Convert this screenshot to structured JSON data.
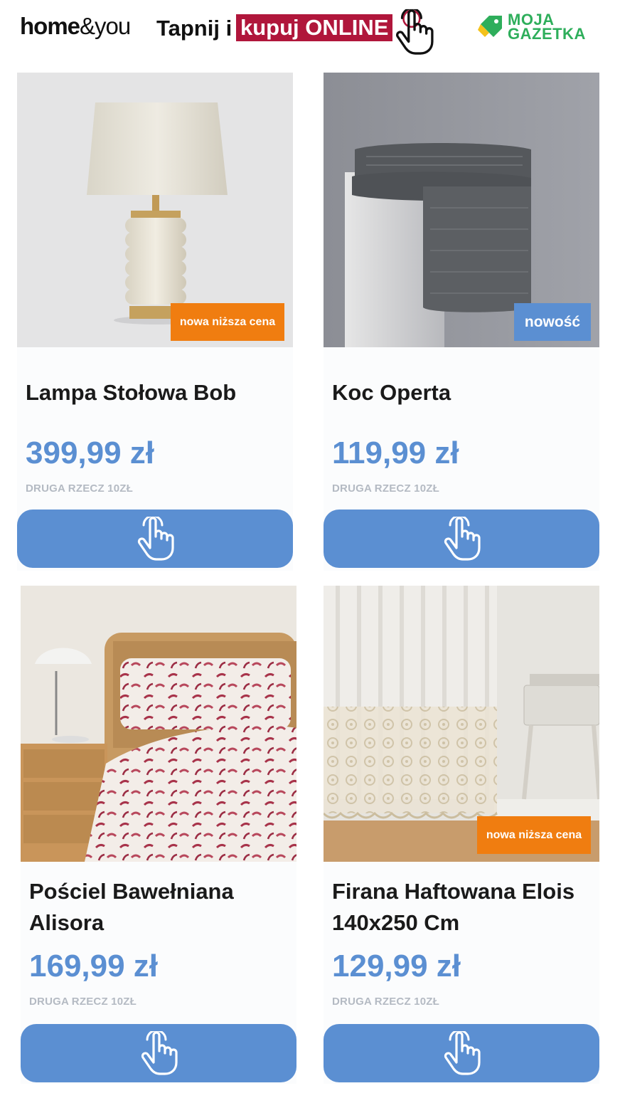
{
  "header": {
    "brand_home": "home",
    "brand_amp": "&",
    "brand_you": "you",
    "tapnij": "Tapnij i",
    "kupuj": "kupuj ONLINE",
    "moja": "MOJA",
    "gazetka": "GAZETKA",
    "accent_color": "#b0163b",
    "gazetka_color": "#2eae5b"
  },
  "products": [
    {
      "title_line1": "Lampa Stołowa Bob",
      "title_line2": "",
      "price": "399,99 zł",
      "promo": "DRUGA RZECZ 10ZŁ",
      "badge": "nowa niższa cena",
      "badge_color": "#f07d10",
      "button_icon": "tap-hand-icon"
    },
    {
      "title_line1": "Koc Operta",
      "title_line2": "",
      "price": "119,99 zł",
      "promo": "DRUGA RZECZ 10ZŁ",
      "badge": "nowość",
      "badge_color": "#5b8fd2",
      "button_icon": "tap-hand-icon"
    },
    {
      "title_line1": "Pościel Bawełniana",
      "title_line2": "Alisora",
      "price": "169,99 zł",
      "promo": "DRUGA RZECZ 10ZŁ",
      "badge": "",
      "button_icon": "tap-hand-icon"
    },
    {
      "title_line1": "Firana Haftowana Elois",
      "title_line2": "140x250 Cm",
      "price": "129,99 zł",
      "promo": "DRUGA RZECZ 10ZŁ",
      "badge": "nowa niższa cena",
      "badge_color": "#f07d10",
      "button_icon": "tap-hand-icon"
    }
  ],
  "colors": {
    "price": "#5b8fd2",
    "button": "#5b8fd2"
  }
}
